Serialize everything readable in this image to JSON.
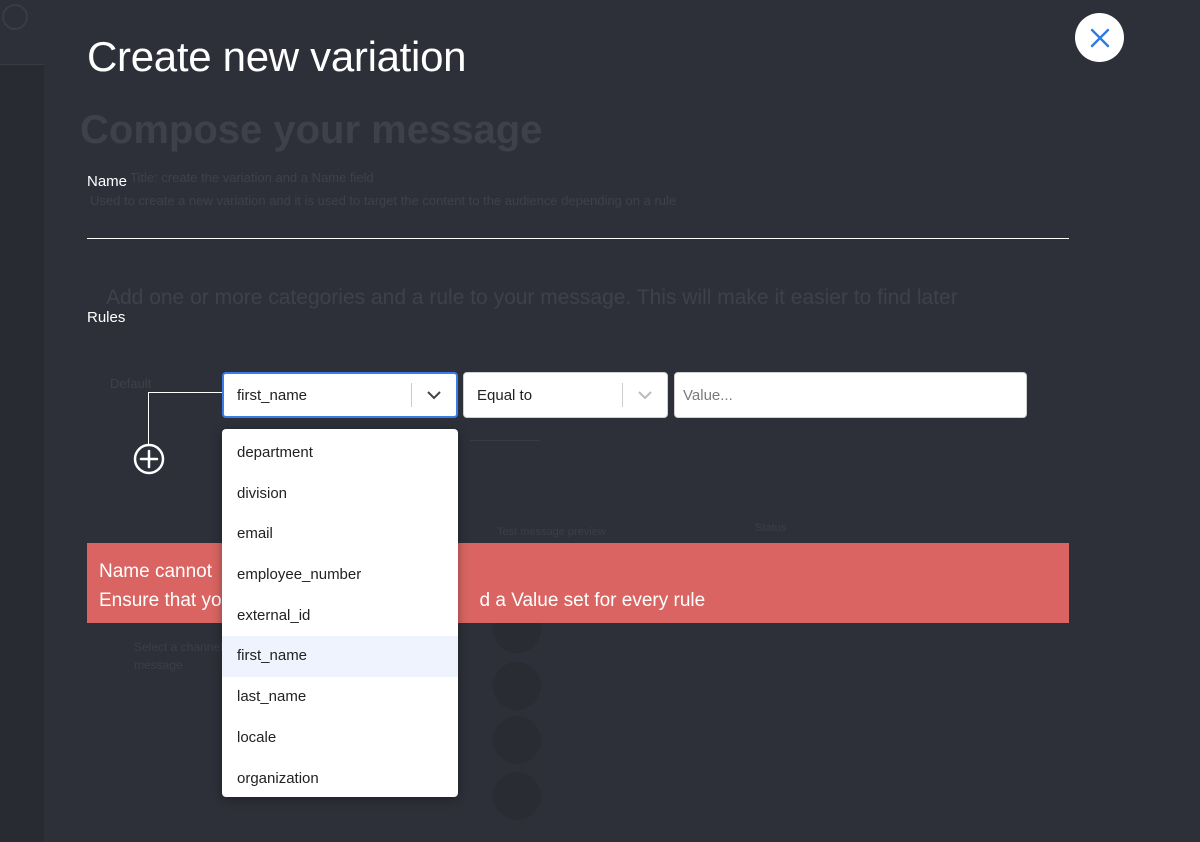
{
  "modal": {
    "title": "Create new variation",
    "name_label": "Name",
    "name_value": "",
    "rules_label": "Rules"
  },
  "rule": {
    "field_value": "first_name",
    "operator_value": "Equal to",
    "value_placeholder": "Value..."
  },
  "dropdown": {
    "options": [
      "department",
      "division",
      "email",
      "employee_number",
      "external_id",
      "first_name",
      "last_name",
      "locale",
      "organization"
    ],
    "selected": "first_name"
  },
  "error": {
    "line1": "Name cannot",
    "line2_start": "Ensure that yo",
    "line2_end": "d a Value set for every rule"
  },
  "background": {
    "title": "Compose your message",
    "line1": "Title: create the variation and a Name field",
    "line2": "Used to create a new variation and it is used to target the content to the audience depending on a rule",
    "line3": "Add one or more categories and a rule to your message. This will make it easier to find later",
    "tab": "Default",
    "column1": "Test message preview",
    "column2": "Status",
    "side_line1": "Select a channel",
    "side_line2": "message"
  },
  "colors": {
    "backdrop": "#2e3039",
    "error": "#d96461",
    "focus": "#3b7de8",
    "close_icon": "#2d7be5",
    "selected_option": "#eef3fd"
  },
  "icons": {
    "close": "close-icon",
    "field_chevron": "chevron-down-icon",
    "operator_chevron": "chevron-down-icon",
    "add_rule": "plus-circle-icon"
  }
}
